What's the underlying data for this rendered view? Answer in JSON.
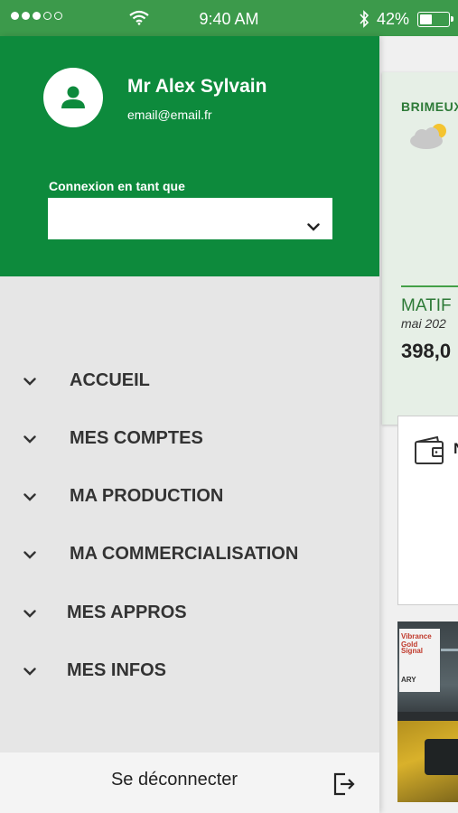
{
  "status_bar": {
    "time": "9:40 AM",
    "battery_percent": "42%",
    "battery_level": 0.42,
    "signal_bars": 3,
    "signal_total": 5
  },
  "drawer": {
    "user": {
      "name": "Mr Alex Sylvain",
      "email": "email@email.fr"
    },
    "connexion": {
      "label": "Connexion en tant que",
      "value": ""
    },
    "menu": [
      {
        "label": "ACCUEIL",
        "icon": "chevron-down-icon"
      },
      {
        "label": "MES COMPTES",
        "icon": "chevron-down-icon"
      },
      {
        "label": "MA PRODUCTION",
        "icon": "chevron-down-icon"
      },
      {
        "label": "MA COMMERCIALISATION",
        "icon": "chevron-down-icon"
      },
      {
        "label": "MES APPROS",
        "icon": "chevron-down-icon"
      },
      {
        "label": "MES INFOS",
        "icon": "chevron-down-icon"
      }
    ],
    "logout": {
      "label": "Se déconnecter",
      "icon": "logout-icon"
    }
  },
  "background": {
    "weather": {
      "city": "BRIMEUX",
      "icon": "partly-cloudy-icon"
    },
    "matif": {
      "label": "MATIF",
      "date": "mai 202",
      "value": "398,0"
    },
    "wallet": {
      "icon": "wallet-icon",
      "title_partial": "N"
    },
    "photo_sign": [
      "Vibrance Gold",
      "Signal",
      "",
      "ARY"
    ]
  },
  "colors": {
    "status_bar": "#3c9a4b",
    "header_green": "#0d8a3c",
    "drawer_bg": "#e6e6e6",
    "menu_text": "#333333"
  }
}
